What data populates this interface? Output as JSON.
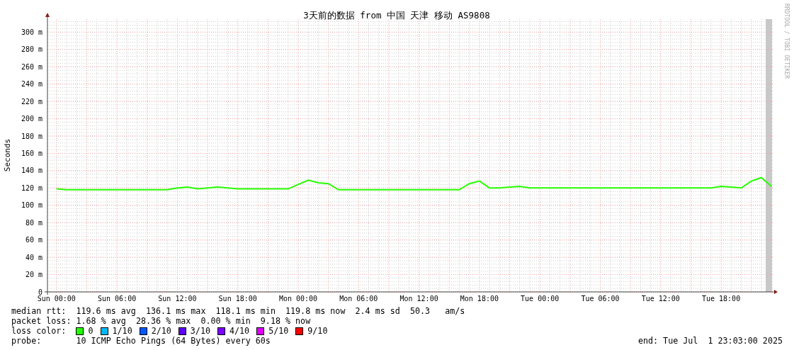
{
  "title": "3天前的数据 from 中国 天津 移动 AS9808",
  "credit": "RRDTOOL / TOBI OETIKER",
  "chart_data": {
    "type": "line",
    "grid": true,
    "ylabel": "Seconds",
    "ylim": [
      0,
      315
    ],
    "categories": [
      "Sun 00:00",
      null,
      null,
      null,
      null,
      null,
      "Sun 06:00",
      null,
      null,
      null,
      null,
      null,
      "Sun 12:00",
      null,
      null,
      null,
      null,
      null,
      "Sun 18:00",
      null,
      null,
      null,
      null,
      null,
      "Mon 00:00",
      null,
      null,
      null,
      null,
      null,
      "Mon 06:00",
      null,
      null,
      null,
      null,
      null,
      "Mon 12:00",
      null,
      null,
      null,
      null,
      null,
      "Mon 18:00",
      null,
      null,
      null,
      null,
      null,
      "Tue 00:00",
      null,
      null,
      null,
      null,
      null,
      "Tue 06:00",
      null,
      null,
      null,
      null,
      null,
      "Tue 12:00",
      null,
      null,
      null,
      null,
      null,
      "Tue 18:00",
      null,
      null,
      null,
      null,
      null
    ],
    "series": [
      {
        "name": "median rtt:",
        "color": "#26ff00",
        "values": [
          119,
          118,
          118,
          118,
          118,
          118,
          118,
          118,
          118,
          118,
          118,
          118,
          120,
          121,
          119,
          120,
          121,
          120,
          119,
          119,
          119,
          119,
          119,
          119,
          124,
          129,
          126,
          125,
          118,
          118,
          118,
          118,
          118,
          118,
          118,
          118,
          118,
          118,
          118,
          118,
          118,
          125,
          128,
          120,
          120,
          121,
          122,
          120,
          120,
          120,
          120,
          120,
          120,
          120,
          120,
          120,
          120,
          120,
          120,
          120,
          120,
          120,
          120,
          120,
          120,
          120,
          122,
          121,
          120,
          128,
          132,
          122
        ]
      }
    ],
    "yticks": [
      {
        "value": 0,
        "label": "0"
      },
      {
        "value": 20,
        "label": "20 m"
      },
      {
        "value": 40,
        "label": "40 m"
      },
      {
        "value": 60,
        "label": "60 m"
      },
      {
        "value": 80,
        "label": "80 m"
      },
      {
        "value": 100,
        "label": "100 m"
      },
      {
        "value": 120,
        "label": "120 m"
      },
      {
        "value": 140,
        "label": "140 m"
      },
      {
        "value": 160,
        "label": "160 m"
      },
      {
        "value": 180,
        "label": "180 m"
      },
      {
        "value": 200,
        "label": "200 m"
      },
      {
        "value": 220,
        "label": "220 m"
      },
      {
        "value": 240,
        "label": "240 m"
      },
      {
        "value": 260,
        "label": "260 m"
      },
      {
        "value": 280,
        "label": "280 m"
      },
      {
        "value": 300,
        "label": "300 m"
      }
    ]
  },
  "rtt_stats": "119.6 ms avg  136.1 ms max  118.1 ms min  119.8 ms now  2.4 ms sd  50.3   am/s",
  "legend": [
    {
      "label": "packet loss:",
      "text": "1.68 % avg  28.36 % max  0.00 % min  9.18 % now"
    }
  ],
  "loss_color": {
    "label": "loss color:",
    "items": [
      {
        "label": "0",
        "color": "#26ff00"
      },
      {
        "label": "1/10",
        "color": "#00b8ff"
      },
      {
        "label": "2/10",
        "color": "#0059ff"
      },
      {
        "label": "3/10",
        "color": "#5e00ff"
      },
      {
        "label": "4/10",
        "color": "#7e00ff"
      },
      {
        "label": "5/10",
        "color": "#dd00ff"
      },
      {
        "label": "9/10",
        "color": "#ff0000"
      }
    ]
  },
  "probe": {
    "label": "probe:",
    "text": "10 ICMP Echo Pings (64 Bytes) every 60s"
  },
  "end": "end: Tue Jul  1 23:03:00 2025"
}
